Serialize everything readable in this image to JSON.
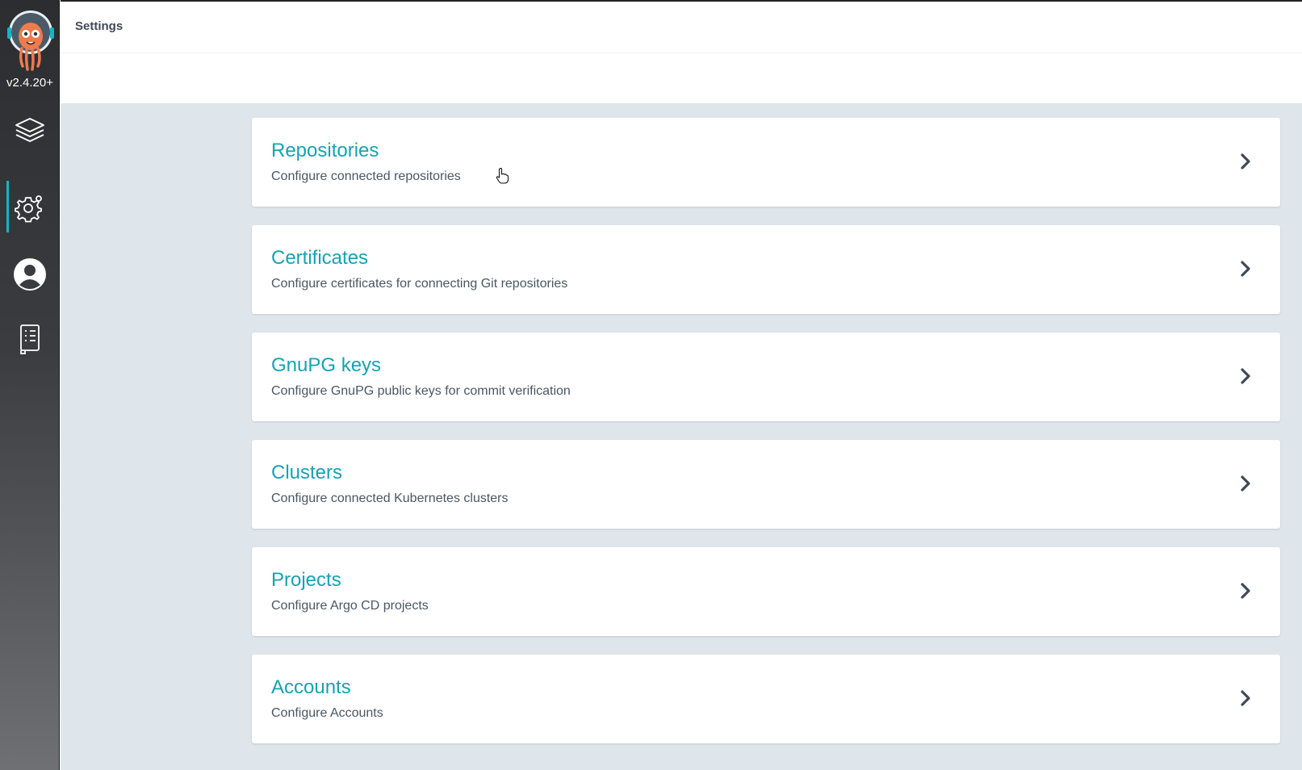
{
  "app": {
    "version": "v2.4.20+"
  },
  "header": {
    "title": "Settings"
  },
  "sidebar": {
    "items": [
      {
        "name": "applications",
        "icon": "layers-icon",
        "active": false
      },
      {
        "name": "settings",
        "icon": "gear-icon",
        "active": true
      },
      {
        "name": "user-info",
        "icon": "user-circle-icon",
        "active": false
      },
      {
        "name": "documentation",
        "icon": "docs-icon",
        "active": false
      }
    ]
  },
  "settings": {
    "cards": [
      {
        "title": "Repositories",
        "description": "Configure connected repositories"
      },
      {
        "title": "Certificates",
        "description": "Configure certificates for connecting Git repositories"
      },
      {
        "title": "GnuPG keys",
        "description": "Configure GnuPG public keys for commit verification"
      },
      {
        "title": "Clusters",
        "description": "Configure connected Kubernetes clusters"
      },
      {
        "title": "Projects",
        "description": "Configure Argo CD projects"
      },
      {
        "title": "Accounts",
        "description": "Configure Accounts"
      }
    ]
  },
  "colors": {
    "accent": "#16a2b3",
    "active_indicator": "#18b3c6",
    "content_bg": "#dee6eb",
    "logo_orange": "#ef7b4d"
  }
}
